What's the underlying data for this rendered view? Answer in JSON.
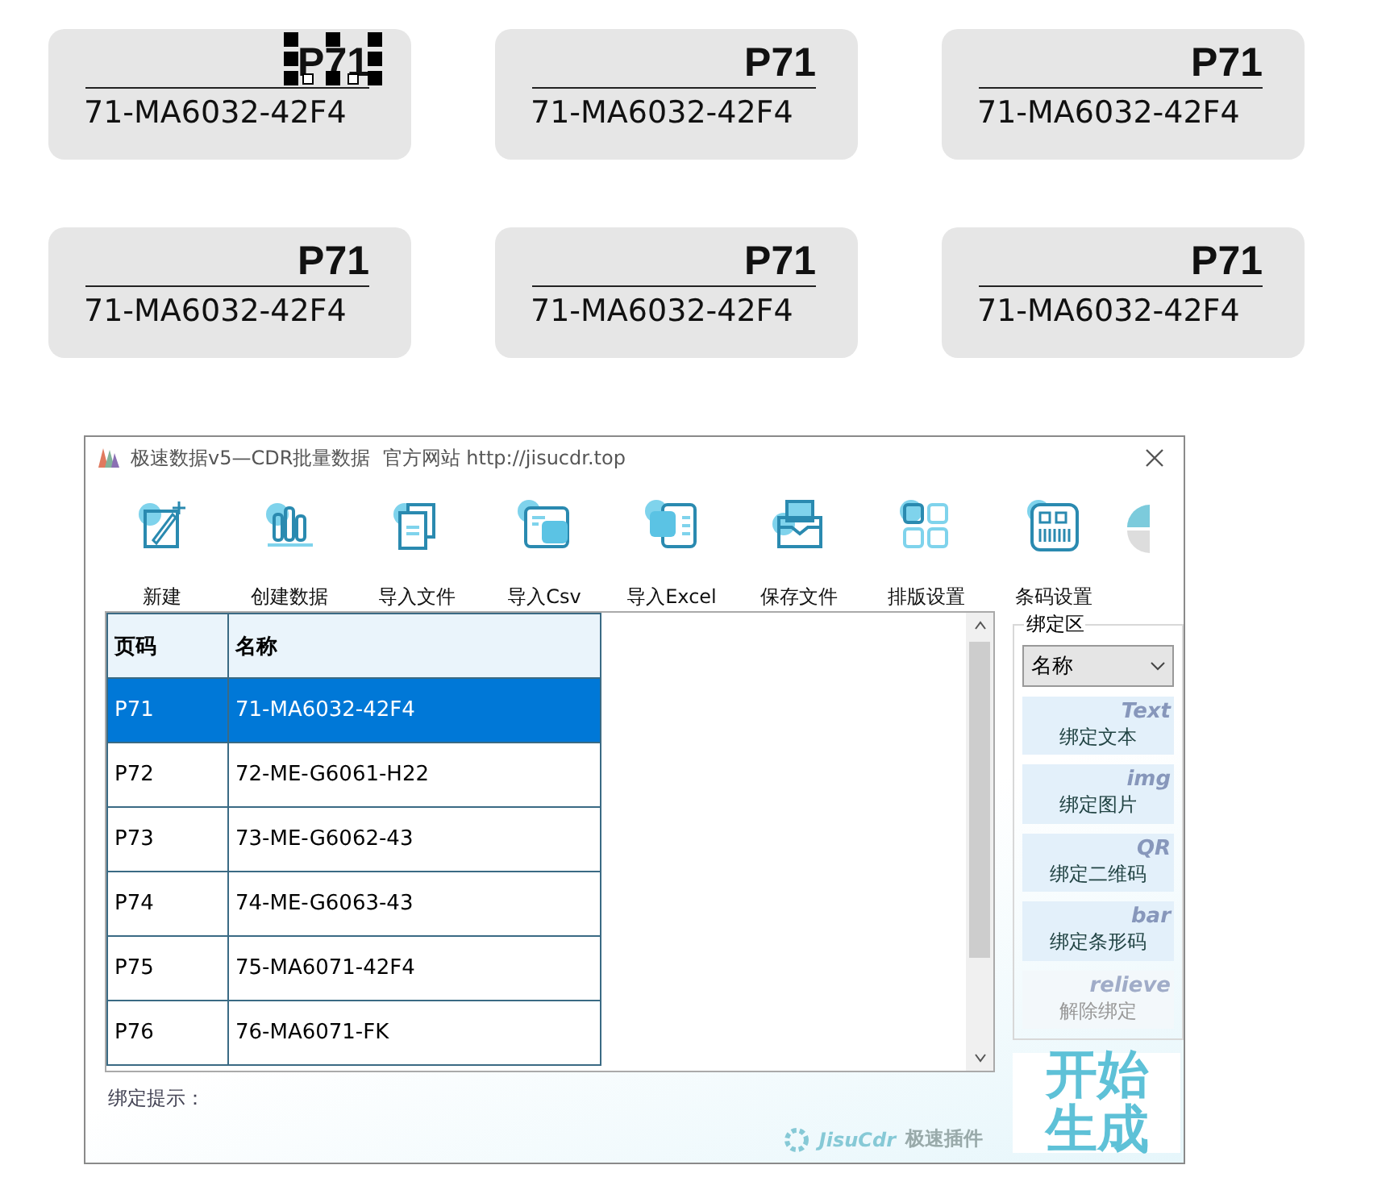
{
  "cards": [
    {
      "code": "P71",
      "name": "71-MA6032-42F4",
      "selected": true
    },
    {
      "code": "P71",
      "name": "71-MA6032-42F4",
      "selected": false
    },
    {
      "code": "P71",
      "name": "71-MA6032-42F4",
      "selected": false
    },
    {
      "code": "P71",
      "name": "71-MA6032-42F4",
      "selected": false
    },
    {
      "code": "P71",
      "name": "71-MA6032-42F4",
      "selected": false
    },
    {
      "code": "P71",
      "name": "71-MA6032-42F4",
      "selected": false
    }
  ],
  "window": {
    "title": "极速数据v5—CDR批量数据  官方网站 http://jisucdr.top"
  },
  "toolbar": [
    {
      "label": "新建"
    },
    {
      "label": "创建数据"
    },
    {
      "label": "导入文件"
    },
    {
      "label": "导入Csv"
    },
    {
      "label": "导入Excel"
    },
    {
      "label": "保存文件"
    },
    {
      "label": "排版设置"
    },
    {
      "label": "条码设置"
    }
  ],
  "table": {
    "columns": [
      "页码",
      "名称"
    ],
    "rows": [
      {
        "cells": [
          "P71",
          "71-MA6032-42F4"
        ],
        "selected": true
      },
      {
        "cells": [
          "P72",
          "72-ME-G6061-H22"
        ],
        "selected": false
      },
      {
        "cells": [
          "P73",
          "73-ME-G6062-43"
        ],
        "selected": false
      },
      {
        "cells": [
          "P74",
          "74-ME-G6063-43"
        ],
        "selected": false
      },
      {
        "cells": [
          "P75",
          "75-MA6071-42F4"
        ],
        "selected": false
      },
      {
        "cells": [
          "P76",
          "76-MA6071-FK"
        ],
        "selected": false
      }
    ]
  },
  "bind_panel": {
    "title": "绑定区",
    "field": {
      "value": "名称"
    },
    "buttons": [
      {
        "label": "绑定文本",
        "hint": "Text",
        "disabled": false
      },
      {
        "label": "绑定图片",
        "hint": "img",
        "disabled": false
      },
      {
        "label": "绑定二维码",
        "hint": "QR",
        "disabled": false
      },
      {
        "label": "绑定条形码",
        "hint": "bar",
        "disabled": false
      },
      {
        "label": "解除绑定",
        "hint": "relieve",
        "disabled": true
      }
    ]
  },
  "start_button": {
    "label": "开始生成"
  },
  "hint_label": "绑定提示：",
  "brand": {
    "name": "JisuCdr",
    "tagline": "极速插件"
  }
}
